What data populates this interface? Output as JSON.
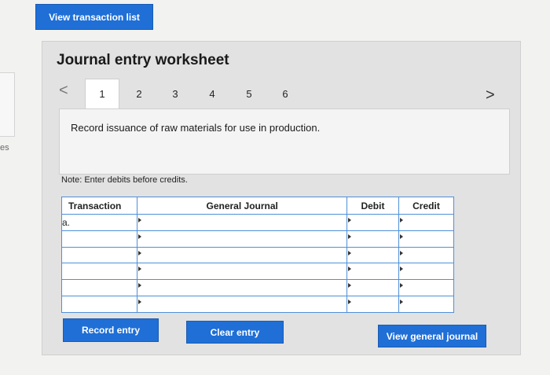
{
  "header": {
    "view_transaction_list": "View transaction list"
  },
  "side_stub": {
    "text": "es"
  },
  "worksheet": {
    "title": "Journal entry worksheet",
    "tabs": [
      {
        "label": "1",
        "active": true
      },
      {
        "label": "2",
        "active": false
      },
      {
        "label": "3",
        "active": false
      },
      {
        "label": "4",
        "active": false
      },
      {
        "label": "5",
        "active": false
      },
      {
        "label": "6",
        "active": false
      }
    ],
    "prev_icon": "chevron-left-icon",
    "next_icon": "chevron-right-icon",
    "prev_glyph": "<",
    "next_glyph": ">",
    "description": "Record issuance of raw materials for use in production.",
    "note": "Note: Enter debits before credits."
  },
  "table": {
    "headers": {
      "transaction": "Transaction",
      "general_journal": "General Journal",
      "debit": "Debit",
      "credit": "Credit"
    },
    "rows": [
      {
        "transaction": "a.",
        "general_journal": "",
        "debit": "",
        "credit": ""
      },
      {
        "transaction": "",
        "general_journal": "",
        "debit": "",
        "credit": ""
      },
      {
        "transaction": "",
        "general_journal": "",
        "debit": "",
        "credit": ""
      },
      {
        "transaction": "",
        "general_journal": "",
        "debit": "",
        "credit": ""
      },
      {
        "transaction": "",
        "general_journal": "",
        "debit": "",
        "credit": ""
      },
      {
        "transaction": "",
        "general_journal": "",
        "debit": "",
        "credit": ""
      }
    ]
  },
  "buttons": {
    "record_entry": "Record entry",
    "clear_entry": "Clear entry",
    "view_general_journal": "View general journal"
  },
  "colors": {
    "accent": "#1f6fd6",
    "grid_border": "#4f8fd8",
    "panel": "#e2e2e2"
  }
}
